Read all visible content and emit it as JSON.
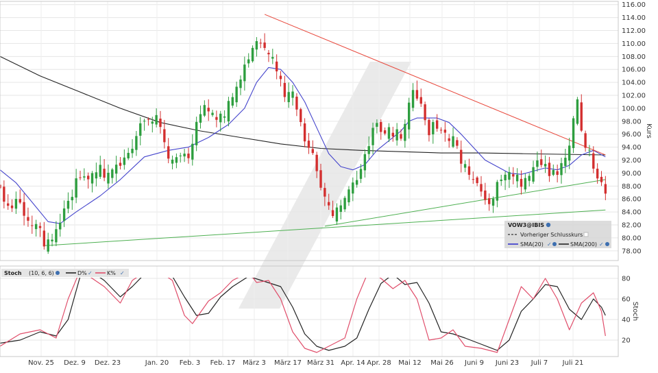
{
  "chart_data": [
    {
      "type": "candlestick",
      "symbol": "VOW3@IBIS",
      "ylabel": "Kurs",
      "yticks": [
        78,
        80,
        82,
        84,
        86,
        88,
        90,
        92,
        94,
        96,
        98,
        100,
        102,
        104,
        106,
        108,
        110,
        112,
        114,
        116
      ],
      "ylim": [
        76.5,
        116.5
      ],
      "x_labels": [
        "Nov. 25",
        "Dez. 9",
        "Dez. 23",
        "Jan. 20",
        "Feb. 3",
        "Feb. 17",
        "März 3",
        "März 17",
        "März 31",
        "Apr. 14",
        "Apr. 28",
        "Mai 12",
        "Mai 26",
        "Juni 9",
        "Juni 23",
        "Juli 7",
        "Juli 21"
      ],
      "legend": {
        "title": "VOW3@IBIS",
        "items": [
          {
            "label": "Vorheriger Schlusskurs",
            "color": "#333333",
            "style": "dashed"
          },
          {
            "label": "SMA(20)",
            "color": "#3333cc"
          },
          {
            "label": "SMA(200)",
            "color": "#222222"
          }
        ]
      },
      "price_path": [
        [
          0,
          88.5
        ],
        [
          3,
          86
        ],
        [
          6,
          84
        ],
        [
          9,
          81.5
        ],
        [
          11,
          80.5
        ],
        [
          13,
          82
        ],
        [
          16,
          86
        ],
        [
          19,
          89
        ],
        [
          23,
          89.5
        ],
        [
          27,
          92
        ],
        [
          31,
          93.5
        ],
        [
          35,
          97.5
        ],
        [
          39,
          98.5
        ],
        [
          43,
          93
        ],
        [
          47,
          94.5
        ],
        [
          51,
          100
        ],
        [
          54,
          98.5
        ],
        [
          57,
          102
        ],
        [
          61,
          108
        ],
        [
          64,
          110.5
        ],
        [
          67,
          109
        ],
        [
          69,
          106
        ],
        [
          71,
          103
        ],
        [
          73,
          104
        ],
        [
          75,
          99
        ],
        [
          77,
          95.5
        ],
        [
          79,
          91
        ],
        [
          81,
          86
        ],
        [
          83,
          84
        ],
        [
          85,
          85.5
        ],
        [
          87,
          89
        ],
        [
          89,
          91
        ],
        [
          91,
          94.5
        ],
        [
          93,
          97.5
        ],
        [
          95,
          97
        ],
        [
          97,
          96.5
        ],
        [
          99,
          96
        ],
        [
          101,
          99
        ],
        [
          103,
          104.5
        ],
        [
          105,
          103
        ],
        [
          107,
          97
        ],
        [
          109,
          97.5
        ],
        [
          111,
          96
        ],
        [
          113,
          95
        ],
        [
          115,
          93.5
        ],
        [
          117,
          91.5
        ],
        [
          119,
          90
        ],
        [
          121,
          88
        ],
        [
          123,
          86.8
        ],
        [
          125,
          89
        ],
        [
          127,
          90.5
        ],
        [
          129,
          89
        ],
        [
          131,
          90.5
        ],
        [
          133,
          92
        ],
        [
          135,
          93.5
        ],
        [
          137,
          91
        ],
        [
          139,
          90.5
        ],
        [
          141,
          92
        ],
        [
          143,
          98
        ],
        [
          144,
          101
        ],
        [
          146,
          96
        ],
        [
          148,
          93
        ],
        [
          150,
          90
        ],
        [
          151,
          88.5
        ]
      ],
      "sma20_path": [
        [
          0,
          90.5
        ],
        [
          4,
          88.5
        ],
        [
          8,
          85.5
        ],
        [
          12,
          82.5
        ],
        [
          15,
          82.2
        ],
        [
          19,
          84
        ],
        [
          25,
          86.5
        ],
        [
          30,
          89
        ],
        [
          36,
          92.5
        ],
        [
          42,
          93.5
        ],
        [
          47,
          94
        ],
        [
          52,
          95.5
        ],
        [
          57,
          97.5
        ],
        [
          61,
          100
        ],
        [
          64,
          104
        ],
        [
          67,
          106.3
        ],
        [
          70,
          106
        ],
        [
          73,
          104
        ],
        [
          76,
          101
        ],
        [
          79,
          97
        ],
        [
          82,
          93
        ],
        [
          85,
          91
        ],
        [
          88,
          90.5
        ],
        [
          91,
          91.3
        ],
        [
          94,
          93.5
        ],
        [
          97,
          95
        ],
        [
          100,
          96.5
        ],
        [
          102,
          98
        ],
        [
          104,
          98.5
        ],
        [
          106,
          98.5
        ],
        [
          109,
          98.5
        ],
        [
          112,
          97.8
        ],
        [
          115,
          96
        ],
        [
          118,
          94
        ],
        [
          121,
          92
        ],
        [
          124,
          91
        ],
        [
          127,
          90
        ],
        [
          130,
          89.8
        ],
        [
          133,
          90.3
        ],
        [
          136,
          90.8
        ],
        [
          139,
          90.5
        ],
        [
          142,
          91.2
        ],
        [
          145,
          92.8
        ],
        [
          148,
          93.5
        ],
        [
          151,
          92.5
        ]
      ],
      "sma200_path": [
        [
          0,
          108
        ],
        [
          10,
          105
        ],
        [
          20,
          102.5
        ],
        [
          30,
          100
        ],
        [
          40,
          97.8
        ],
        [
          50,
          96.5
        ],
        [
          60,
          95.5
        ],
        [
          70,
          94.5
        ],
        [
          80,
          93.8
        ],
        [
          90,
          93.5
        ],
        [
          100,
          93.3
        ],
        [
          110,
          93.1
        ],
        [
          120,
          93.1
        ],
        [
          130,
          93.0
        ],
        [
          140,
          92.9
        ],
        [
          151,
          92.8
        ]
      ],
      "trendlines": [
        {
          "name": "down",
          "color": "#e8473b",
          "from": [
            66,
            114.5
          ],
          "to": [
            151,
            92.8
          ]
        },
        {
          "name": "support-long",
          "color": "#4caf50",
          "from": [
            11,
            78.8
          ],
          "to": [
            151,
            84.3
          ]
        },
        {
          "name": "support-short",
          "color": "#4caf50",
          "from": [
            81,
            81.8
          ],
          "to": [
            151,
            89
          ]
        }
      ],
      "day_of_last_label_bar": 151
    },
    {
      "type": "line",
      "indicator": "Stoch",
      "params": "(10, 6, 6)",
      "ylabel": "Stoch",
      "yticks": [
        20,
        40,
        60,
        80
      ],
      "ylim": [
        4,
        92
      ],
      "series": [
        {
          "name": "D%",
          "color": "#222222",
          "values_path": [
            [
              0,
              17
            ],
            [
              5,
              20
            ],
            [
              10,
              28
            ],
            [
              14,
              24
            ],
            [
              17,
              40
            ],
            [
              20,
              82
            ],
            [
              23,
              86
            ],
            [
              26,
              78
            ],
            [
              30,
              62
            ],
            [
              33,
              72
            ],
            [
              36,
              84
            ],
            [
              40,
              86
            ],
            [
              43,
              82
            ],
            [
              46,
              62
            ],
            [
              49,
              44
            ],
            [
              52,
              46
            ],
            [
              55,
              62
            ],
            [
              58,
              72
            ],
            [
              62,
              82
            ],
            [
              66,
              77
            ],
            [
              70,
              72
            ],
            [
              73,
              52
            ],
            [
              76,
              26
            ],
            [
              79,
              14
            ],
            [
              82,
              10
            ],
            [
              86,
              14
            ],
            [
              89,
              22
            ],
            [
              92,
              50
            ],
            [
              95,
              75
            ],
            [
              98,
              84
            ],
            [
              101,
              74
            ],
            [
              104,
              76
            ],
            [
              107,
              56
            ],
            [
              110,
              28
            ],
            [
              113,
              26
            ],
            [
              116,
              22
            ],
            [
              120,
              16
            ],
            [
              124,
              10
            ],
            [
              127,
              20
            ],
            [
              130,
              48
            ],
            [
              133,
              60
            ],
            [
              136,
              74
            ],
            [
              139,
              72
            ],
            [
              142,
              50
            ],
            [
              145,
              40
            ],
            [
              148,
              60
            ],
            [
              150,
              52
            ],
            [
              151,
              44
            ]
          ]
        },
        {
          "name": "K%",
          "color": "#e04d6a",
          "values_path": [
            [
              0,
              14
            ],
            [
              5,
              26
            ],
            [
              10,
              30
            ],
            [
              14,
              22
            ],
            [
              17,
              60
            ],
            [
              20,
              88
            ],
            [
              23,
              80
            ],
            [
              26,
              72
            ],
            [
              30,
              56
            ],
            [
              33,
              78
            ],
            [
              36,
              86
            ],
            [
              40,
              86
            ],
            [
              43,
              78
            ],
            [
              46,
              44
            ],
            [
              48,
              36
            ],
            [
              52,
              58
            ],
            [
              55,
              66
            ],
            [
              58,
              78
            ],
            [
              62,
              86
            ],
            [
              64,
              76
            ],
            [
              67,
              78
            ],
            [
              70,
              60
            ],
            [
              73,
              28
            ],
            [
              76,
              12
            ],
            [
              79,
              8
            ],
            [
              82,
              14
            ],
            [
              86,
              22
            ],
            [
              89,
              60
            ],
            [
              92,
              88
            ],
            [
              95,
              80
            ],
            [
              98,
              70
            ],
            [
              101,
              78
            ],
            [
              104,
              60
            ],
            [
              107,
              20
            ],
            [
              110,
              22
            ],
            [
              113,
              30
            ],
            [
              116,
              14
            ],
            [
              120,
              12
            ],
            [
              124,
              8
            ],
            [
              127,
              40
            ],
            [
              130,
              72
            ],
            [
              133,
              60
            ],
            [
              136,
              80
            ],
            [
              139,
              60
            ],
            [
              142,
              30
            ],
            [
              145,
              56
            ],
            [
              148,
              66
            ],
            [
              150,
              48
            ],
            [
              151,
              24
            ]
          ]
        }
      ]
    }
  ]
}
